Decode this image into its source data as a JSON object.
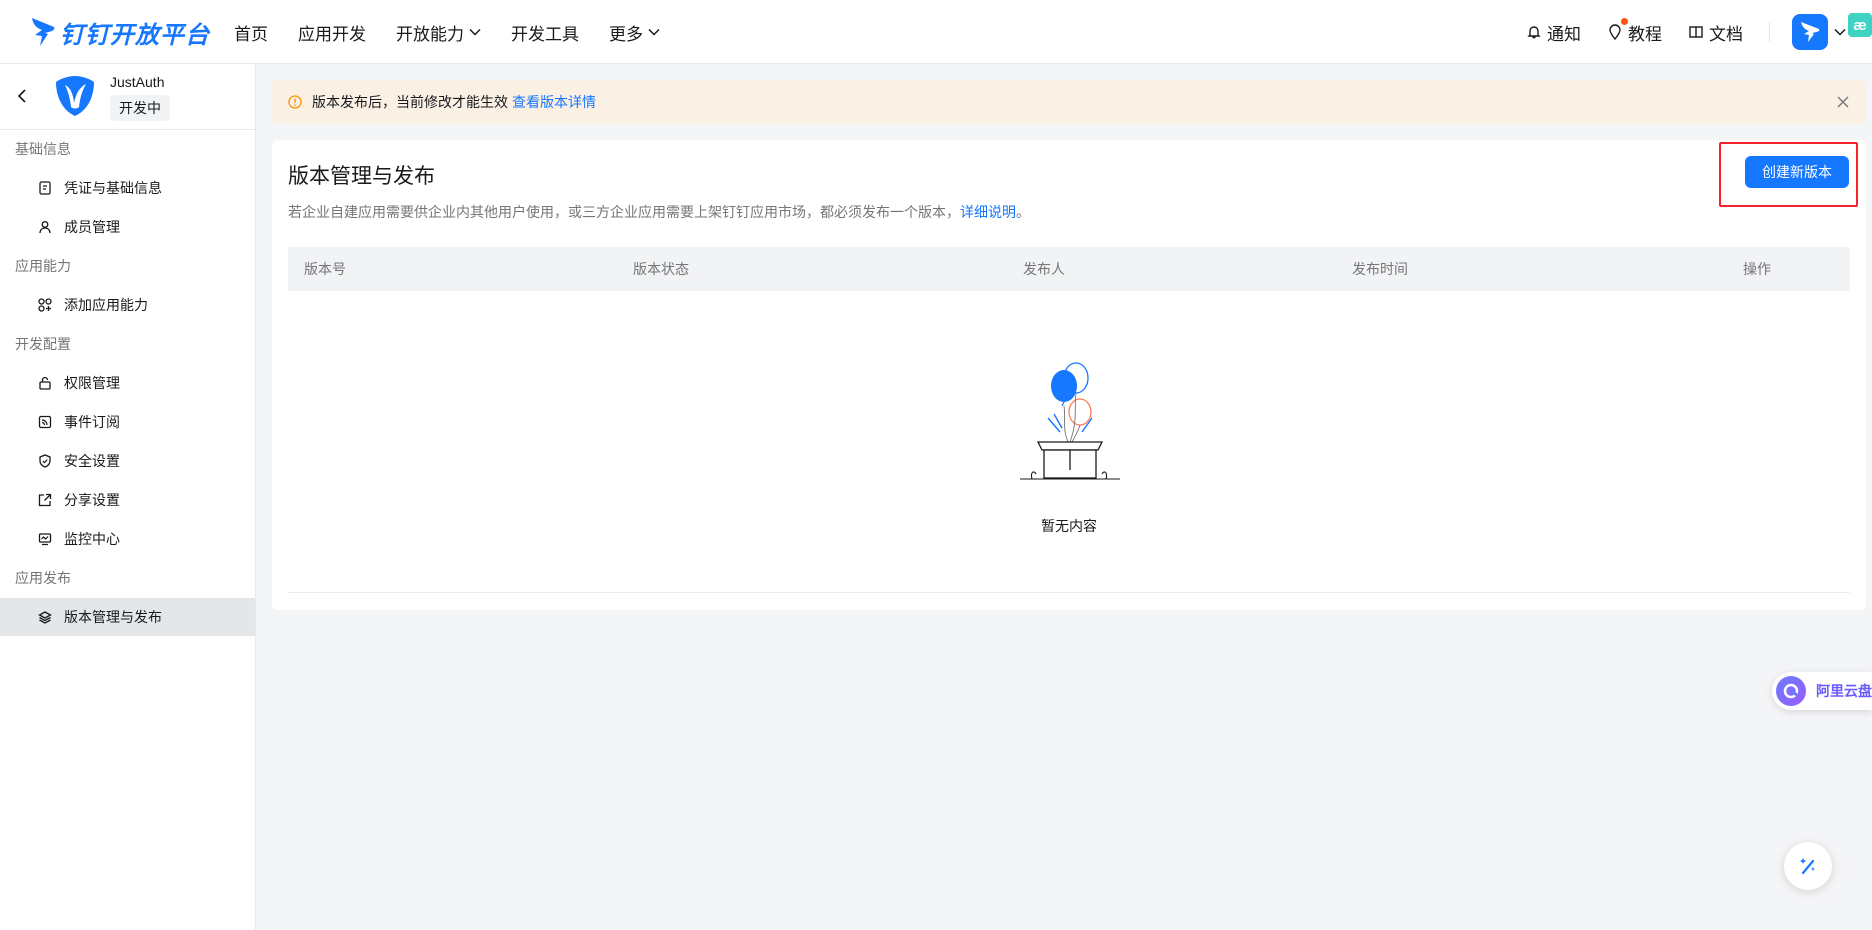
{
  "brand": {
    "name": "钉钉开放平台",
    "logo_icon": "dingtalk-bird-icon",
    "color": "#1677ff"
  },
  "nav": {
    "items": [
      {
        "label": "首页",
        "has_dropdown": false
      },
      {
        "label": "应用开发",
        "has_dropdown": false
      },
      {
        "label": "开放能力",
        "has_dropdown": true
      },
      {
        "label": "开发工具",
        "has_dropdown": false
      },
      {
        "label": "更多",
        "has_dropdown": true
      }
    ]
  },
  "tools": {
    "notify_label": "通知",
    "tutorial_label": "教程",
    "docs_label": "文档",
    "org_badge_text": "æ"
  },
  "app": {
    "name": "JustAuth",
    "status": "开发中"
  },
  "sidebar": {
    "groups": [
      {
        "title": "基础信息",
        "items": [
          {
            "label": "凭证与基础信息",
            "icon": "credential-icon"
          },
          {
            "label": "成员管理",
            "icon": "user-icon"
          }
        ]
      },
      {
        "title": "应用能力",
        "items": [
          {
            "label": "添加应用能力",
            "icon": "apps-icon"
          }
        ]
      },
      {
        "title": "开发配置",
        "items": [
          {
            "label": "权限管理",
            "icon": "lock-icon"
          },
          {
            "label": "事件订阅",
            "icon": "rss-icon"
          },
          {
            "label": "安全设置",
            "icon": "shield-icon"
          },
          {
            "label": "分享设置",
            "icon": "share-icon"
          },
          {
            "label": "监控中心",
            "icon": "monitor-icon"
          }
        ]
      },
      {
        "title": "应用发布",
        "items": [
          {
            "label": "版本管理与发布",
            "icon": "layers-icon",
            "active": true
          }
        ]
      }
    ]
  },
  "alert": {
    "text": "版本发布后，当前修改才能生效",
    "link": "查看版本详情"
  },
  "main": {
    "title": "版本管理与发布",
    "description": "若企业自建应用需要供企业内其他用户使用，或三方企业应用需要上架钉钉应用市场，都必须发布一个版本，",
    "description_link": "详细说明",
    "description_end": "。",
    "create_button": "创建新版本",
    "table": {
      "columns": [
        "版本号",
        "版本状态",
        "发布人",
        "发布时间",
        "操作"
      ]
    },
    "empty_text": "暂无内容"
  },
  "floating": {
    "ali_label": "阿里云盘"
  }
}
